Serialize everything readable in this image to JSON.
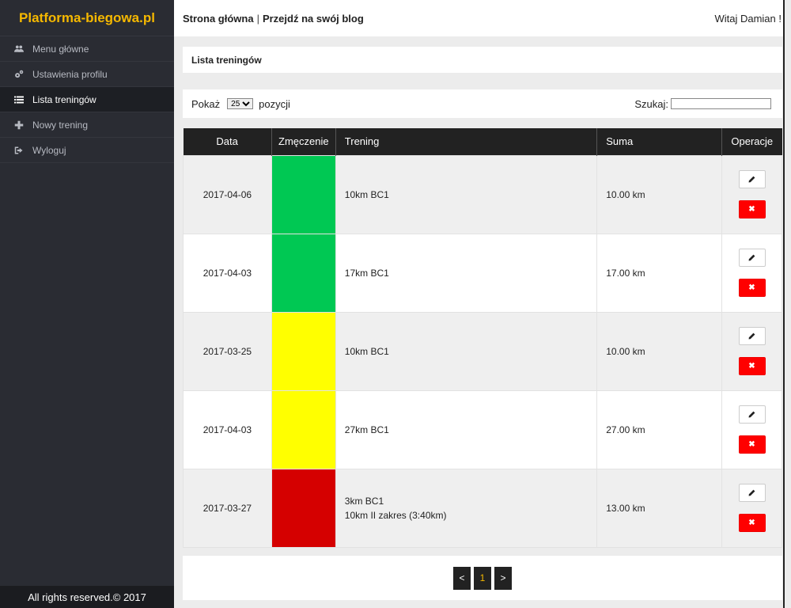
{
  "sidebar": {
    "brand": "Platforma-biegowa.pl",
    "items": [
      {
        "label": "Menu główne",
        "icon": "users-icon"
      },
      {
        "label": "Ustawienia profilu",
        "icon": "gears-icon"
      },
      {
        "label": "Lista treningów",
        "icon": "list-icon",
        "active": true
      },
      {
        "label": "Nowy trening",
        "icon": "plus-icon"
      },
      {
        "label": "Wyloguj",
        "icon": "sign-out-icon"
      }
    ],
    "footer": "All rights reserved.© 2017"
  },
  "topbar": {
    "home_link": "Strona główna",
    "separator": "|",
    "blog_link": "Przejdź na swój blog",
    "welcome": "Witaj Damian !"
  },
  "page": {
    "title": "Lista treningów"
  },
  "controls": {
    "show_label": "Pokaż",
    "page_size": "25",
    "positions_label": "pozycji",
    "search_label": "Szukaj:",
    "search_value": ""
  },
  "table": {
    "headers": [
      "Data",
      "Zmęczenie",
      "Trening",
      "Suma",
      "Operacje"
    ],
    "rows": [
      {
        "date": "2017-04-06",
        "fatigue_color": "#00c853",
        "training": [
          "10km BC1"
        ],
        "sum": "10.00 km"
      },
      {
        "date": "2017-04-03",
        "fatigue_color": "#00c853",
        "training": [
          "17km BC1"
        ],
        "sum": "17.00 km"
      },
      {
        "date": "2017-03-25",
        "fatigue_color": "#ffff00",
        "training": [
          "10km BC1"
        ],
        "sum": "10.00 km"
      },
      {
        "date": "2017-04-03",
        "fatigue_color": "#ffff00",
        "training": [
          "27km BC1"
        ],
        "sum": "27.00 km"
      },
      {
        "date": "2017-03-27",
        "fatigue_color": "#d50000",
        "training": [
          "3km BC1",
          "10km II zakres (3:40km)"
        ],
        "sum": "13.00 km"
      }
    ]
  },
  "pagination": {
    "prev": "<",
    "current": "1",
    "next": ">"
  },
  "colors": {
    "brand": "#f5b800",
    "sidebar_bg": "#2a2c33",
    "delete": "#ff0000"
  }
}
